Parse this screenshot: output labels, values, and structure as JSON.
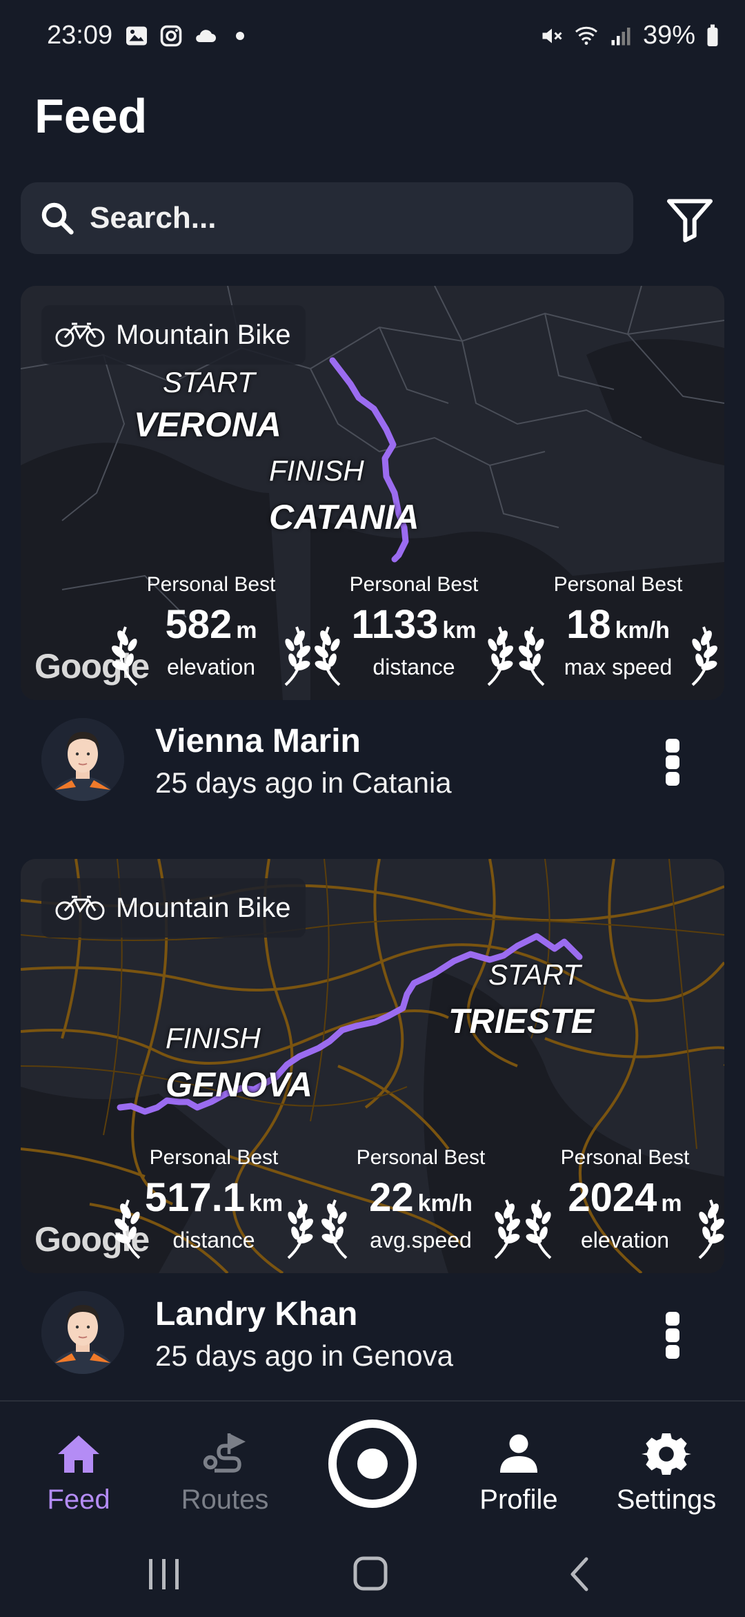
{
  "status_bar": {
    "time": "23:09",
    "battery": "39%"
  },
  "header": {
    "title": "Feed"
  },
  "search": {
    "placeholder": "Search..."
  },
  "activities": [
    {
      "type": "Mountain Bike",
      "start_label": "START",
      "start_city": "VERONA",
      "finish_label": "FINISH",
      "finish_city": "CATANIA",
      "map_credit": "Google",
      "stats": [
        {
          "badge": "Personal Best",
          "value": "582",
          "unit": "m",
          "label": "elevation"
        },
        {
          "badge": "Personal Best",
          "value": "1133",
          "unit": "km",
          "label": "distance"
        },
        {
          "badge": "Personal Best",
          "value": "18",
          "unit": "km/h",
          "label": "max speed"
        }
      ],
      "user": {
        "name": "Vienna Marin",
        "meta": "25 days ago in Catania"
      }
    },
    {
      "type": "Mountain Bike",
      "start_label": "START",
      "start_city": "TRIESTE",
      "finish_label": "FINISH",
      "finish_city": "GENOVA",
      "map_credit": "Google",
      "stats": [
        {
          "badge": "Personal Best",
          "value": "517.1",
          "unit": "km",
          "label": "distance"
        },
        {
          "badge": "Personal Best",
          "value": "22",
          "unit": "km/h",
          "label": "avg.speed"
        },
        {
          "badge": "Personal Best",
          "value": "2024",
          "unit": "m",
          "label": "elevation"
        }
      ],
      "user": {
        "name": "Landry Khan",
        "meta": "25 days ago in Genova"
      }
    }
  ],
  "bottom_nav": {
    "feed": "Feed",
    "routes": "Routes",
    "profile": "Profile",
    "settings": "Settings"
  },
  "colors": {
    "accent": "#b48cf5",
    "route": "#9b6cf0",
    "background": "#161b27",
    "roads": "#7a5410"
  }
}
